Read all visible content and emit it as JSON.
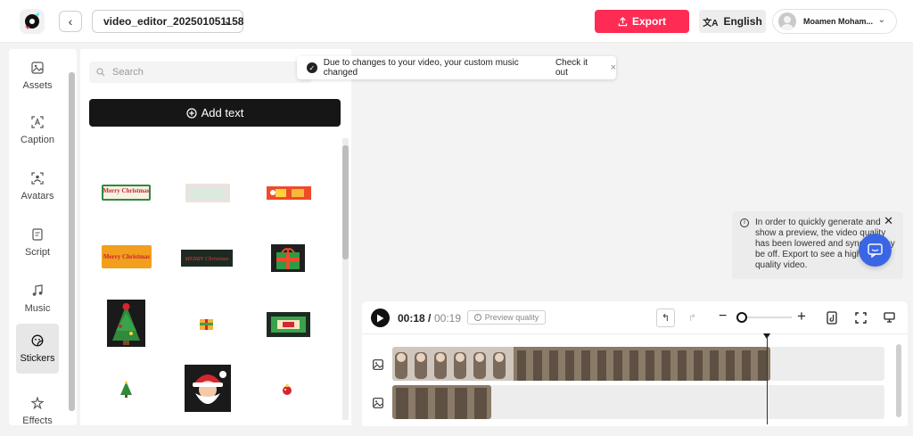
{
  "topbar": {
    "project_name": "video_editor_202501051158",
    "export_label": "Export",
    "language_label": "English",
    "user_name": "Moamen Moham..."
  },
  "sidebar": {
    "items": [
      {
        "label": "Assets",
        "icon": "image-icon"
      },
      {
        "label": "Caption",
        "icon": "caption-icon"
      },
      {
        "label": "Avatars",
        "icon": "avatar-icon"
      },
      {
        "label": "Script",
        "icon": "script-icon"
      },
      {
        "label": "Music",
        "icon": "music-icon"
      },
      {
        "label": "Stickers",
        "icon": "sticker-icon",
        "active": true
      },
      {
        "label": "Effects",
        "icon": "effects-icon"
      }
    ]
  },
  "panel": {
    "search_placeholder": "Search",
    "add_text_label": "Add text",
    "stickers": [
      {
        "name": "merry-christmas-red-sticker",
        "text": "Merry Christmas"
      },
      {
        "name": "faded-christmas-sticker",
        "text": ""
      },
      {
        "name": "christmas-gift-banner-sticker",
        "text": ""
      },
      {
        "name": "merry-christmas-orange-sticker",
        "text": "Merry Christmas"
      },
      {
        "name": "merry-christmas-dark-sticker",
        "text": "MERRY Christmas"
      },
      {
        "name": "gift-box-green-sticker",
        "text": ""
      },
      {
        "name": "christmas-tree-sticker",
        "text": ""
      },
      {
        "name": "small-gift-sticker",
        "text": ""
      },
      {
        "name": "christmas-sale-sticker",
        "text": ""
      },
      {
        "name": "tiny-tree-sticker",
        "text": ""
      },
      {
        "name": "santa-claus-sticker",
        "text": ""
      },
      {
        "name": "ornament-sticker",
        "text": ""
      }
    ]
  },
  "toast": {
    "message": "Due to changes to your video, your custom music changed",
    "link": "Check it out",
    "close": "×"
  },
  "notice": {
    "text": "In order to quickly generate and show a preview, the video quality has been lowered and syncing may be off. Export to see a higher-quality video.",
    "close": "✕"
  },
  "timeline": {
    "current_time": "00:18",
    "separator": "/",
    "total_time": "00:19",
    "preview_quality_label": "Preview quality"
  },
  "colors": {
    "export": "#fe2c55",
    "chat_fab": "#3a66e6",
    "dark_button": "#161616"
  }
}
